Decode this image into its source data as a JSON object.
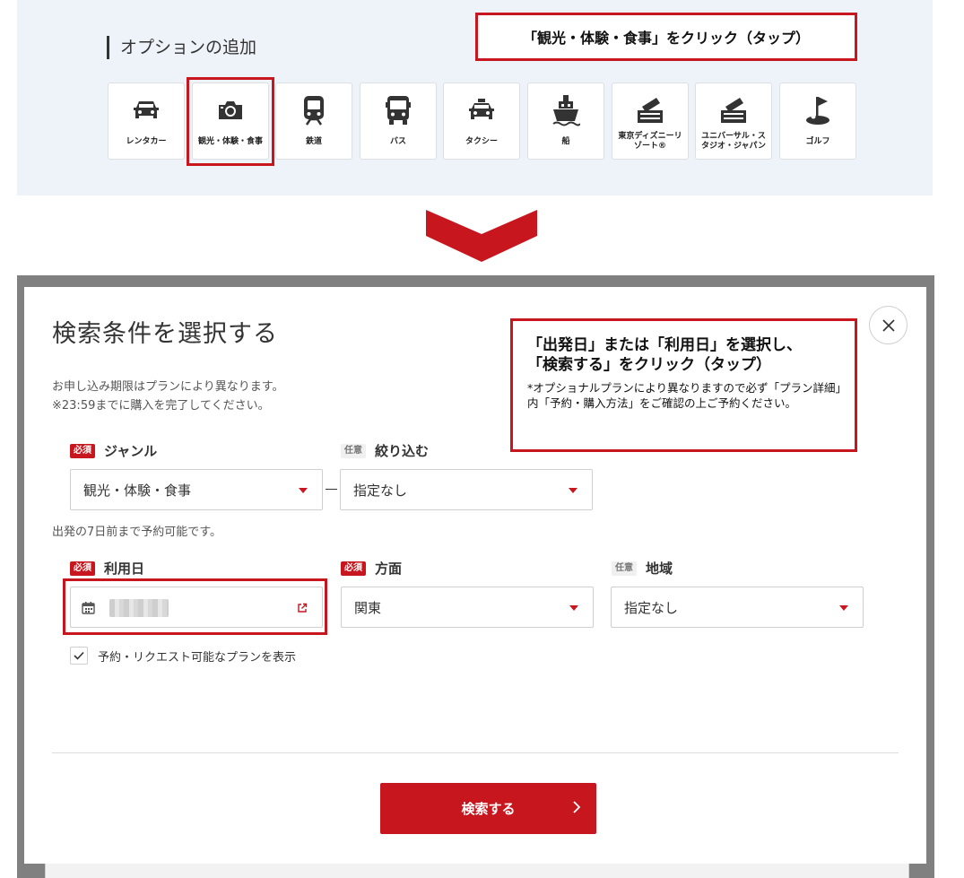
{
  "options": {
    "title": "オプションの追加",
    "callout": "「観光・体験・食事」をクリック（タップ）",
    "tiles": [
      {
        "label": "レンタカー",
        "icon": "car-icon"
      },
      {
        "label": "観光・体験・食事",
        "icon": "camera-icon"
      },
      {
        "label": "鉄道",
        "icon": "train-icon"
      },
      {
        "label": "バス",
        "icon": "bus-icon"
      },
      {
        "label": "タクシー",
        "icon": "taxi-icon"
      },
      {
        "label": "船",
        "icon": "ship-icon"
      },
      {
        "label": "東京ディズニーリゾート®",
        "icon": "ticket-icon"
      },
      {
        "label": "ユニバーサル・スタジオ・ジャパン",
        "icon": "ticket-icon"
      },
      {
        "label": "ゴルフ",
        "icon": "golf-icon"
      }
    ]
  },
  "modal": {
    "title": "検索条件を選択する",
    "note1": "お申し込み期限はプランにより異なります。",
    "note2": "※23:59までに購入を完了してください。",
    "callout": {
      "line1": "「出発日」または「利用日」を選択し、",
      "line2": "「検索する」をクリック（タップ）",
      "small": "*オプショナルプランにより異なりますので必ず「プラン詳細」内「予約・購入方法」をご確認の上ご予約ください。"
    },
    "badges": {
      "required": "必須",
      "optional": "任意"
    },
    "genre": {
      "label": "ジャンル",
      "value": "観光・体験・食事"
    },
    "refine": {
      "label": "絞り込む",
      "value": "指定なし"
    },
    "advance_note": "出発の7日前まで予約可能です。",
    "use_date": {
      "label": "利用日"
    },
    "direction": {
      "label": "方面",
      "value": "関東"
    },
    "region": {
      "label": "地域",
      "value": "指定なし"
    },
    "checkbox_label": "予約・リクエスト可能なプランを表示",
    "search_button": "検索する"
  },
  "colors": {
    "accent": "#c8161e",
    "panel_bg": "#eef3fa"
  }
}
